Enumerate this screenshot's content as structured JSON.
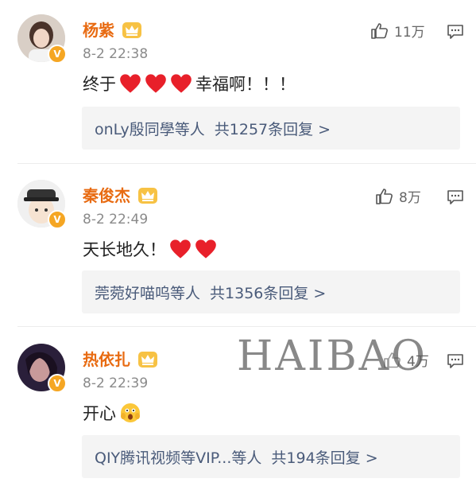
{
  "comments": [
    {
      "name": "杨紫",
      "time": "8-2 22:38",
      "text": "终于",
      "text_after": "幸福啊！！！",
      "hearts": 3,
      "likes": "11万",
      "replies_users": "onLy殷同學等人",
      "replies_count": "共1257条回复 >"
    },
    {
      "name": "秦俊杰",
      "time": "8-2 22:49",
      "text": "天长地久！",
      "text_after": "",
      "hearts": 2,
      "likes": "8万",
      "replies_users": "莞菀好喵呜等人",
      "replies_count": "共1356条回复 >"
    },
    {
      "name": "热依扎",
      "time": "8-2 22:39",
      "text": "开心",
      "text_after": "",
      "hearts": 0,
      "likes": "4万",
      "replies_users": "QIY腾讯视频等VIP...等人",
      "replies_count": "共194条回复 >"
    }
  ],
  "watermark": "HAIBAO",
  "colors": {
    "username": "#e86b12",
    "reply_link": "#4a5b7a",
    "heart": "#e8202a",
    "verified_badge": "#f5a623"
  },
  "icons": {
    "like": "thumbs-up-icon",
    "comment": "comment-bubble-icon",
    "verified": "verified-v-icon",
    "crown": "crown-badge-icon",
    "emoji": "shocked-face-emoji-icon"
  }
}
